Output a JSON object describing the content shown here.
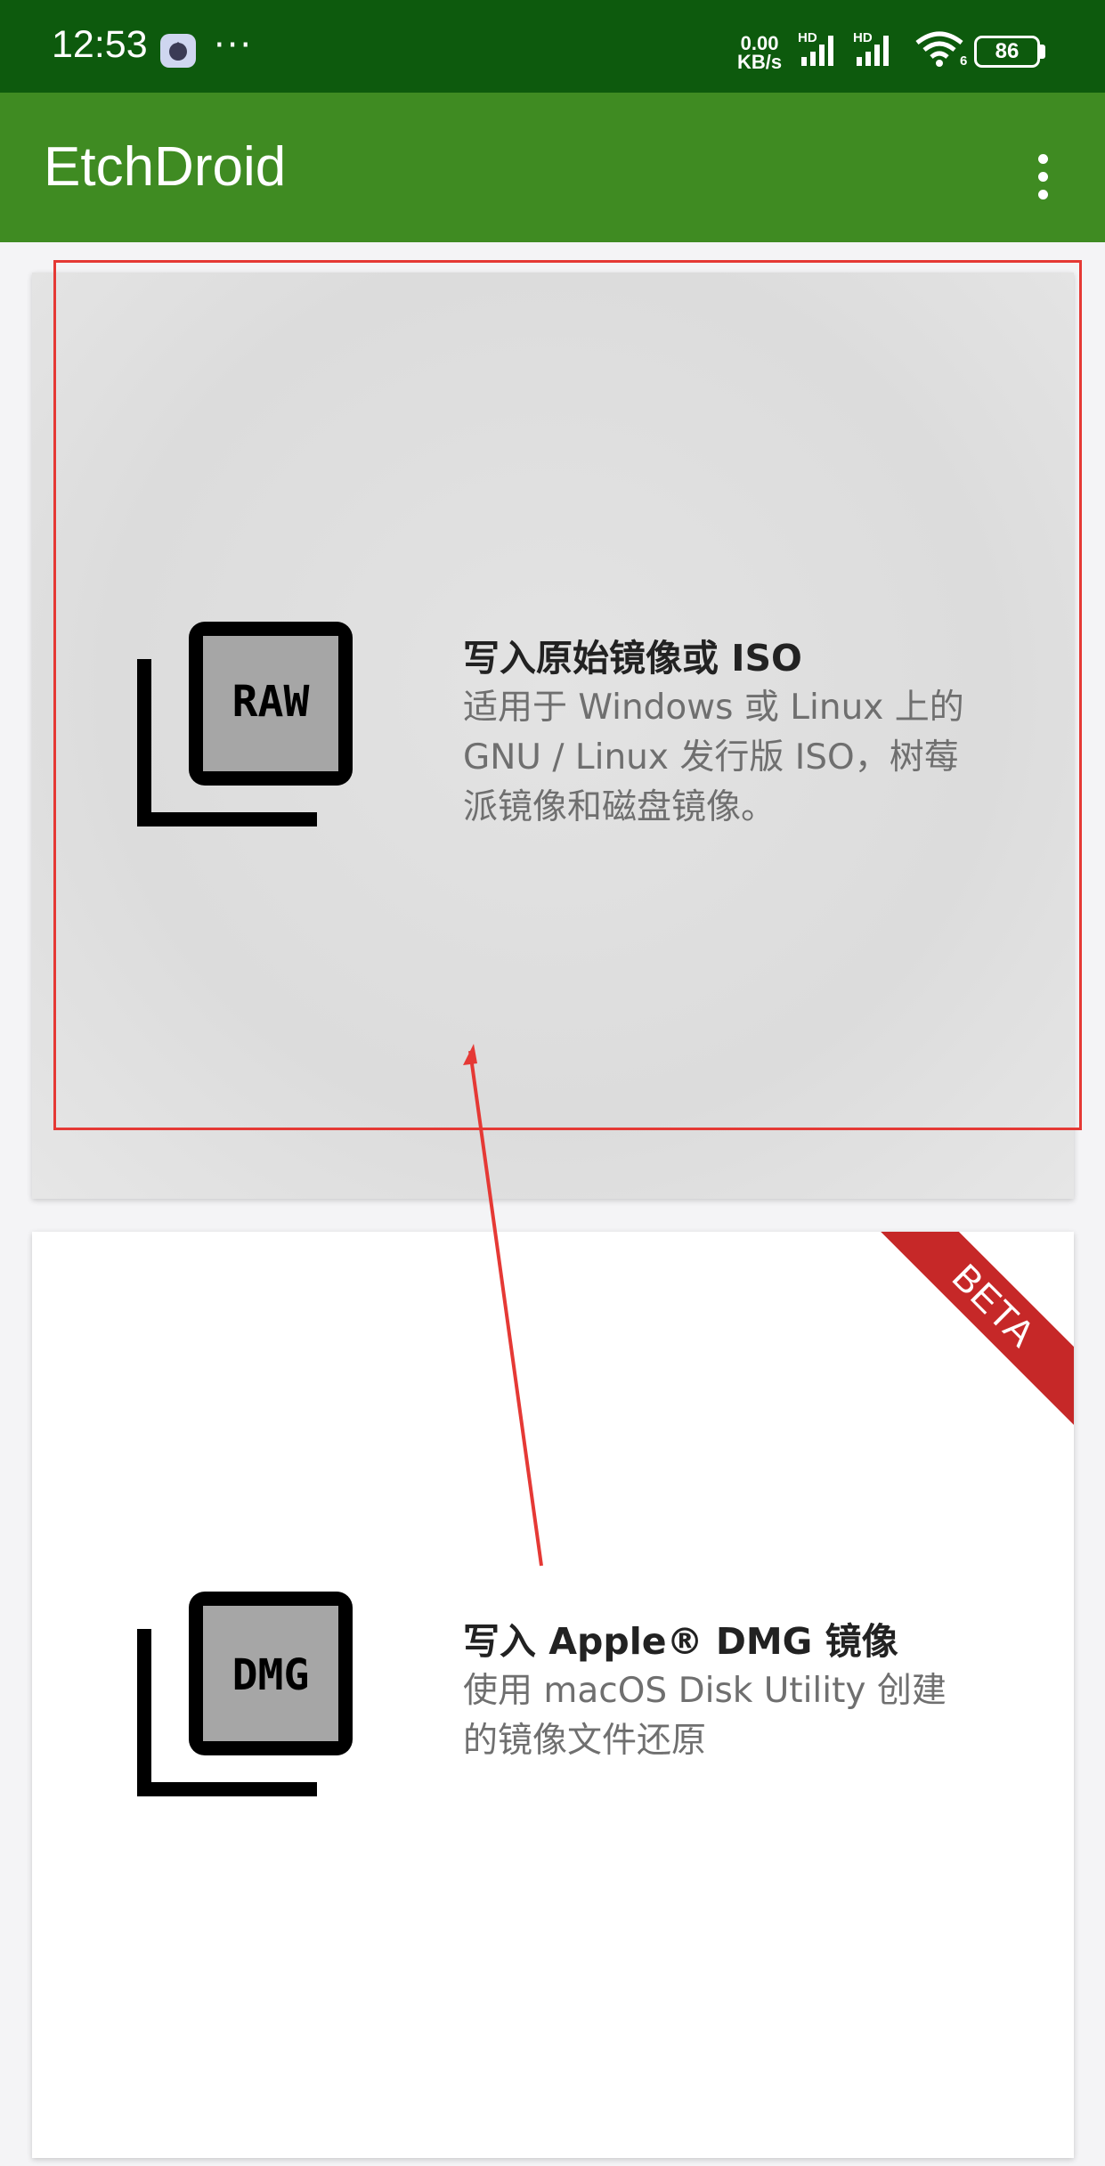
{
  "status_bar": {
    "time": "12:53",
    "dots": "···",
    "net_speed_value": "0.00",
    "net_speed_unit": "KB/s",
    "sim1_label": "HD",
    "sim2_label": "HD",
    "wifi_sub": "6",
    "battery": "86",
    "icons": [
      "app-notification-icon",
      "signal-icon",
      "signal-icon",
      "wifi-icon",
      "battery-icon"
    ]
  },
  "app_bar": {
    "title": "EtchDroid",
    "menu_icon": "more-vert-icon"
  },
  "cards": [
    {
      "icon_text": "RAW",
      "title": "写入原始镜像或 ISO",
      "description_lines": [
        "适用于 Windows 或 Linux 上的",
        "GNU / Linux 发行版 ISO，树莓",
        "派镜像和磁盘镜像。"
      ]
    },
    {
      "icon_text": "DMG",
      "title": "写入 Apple® DMG 镜像",
      "description_lines": [
        "使用 macOS Disk Utility 创建",
        "的镜像文件还原"
      ],
      "badge": "BETA"
    }
  ],
  "colors": {
    "status_bar": "#0d5a0d",
    "app_bar": "#3f8b22",
    "beta_ribbon": "#c62828",
    "annotation": "#e53935"
  }
}
